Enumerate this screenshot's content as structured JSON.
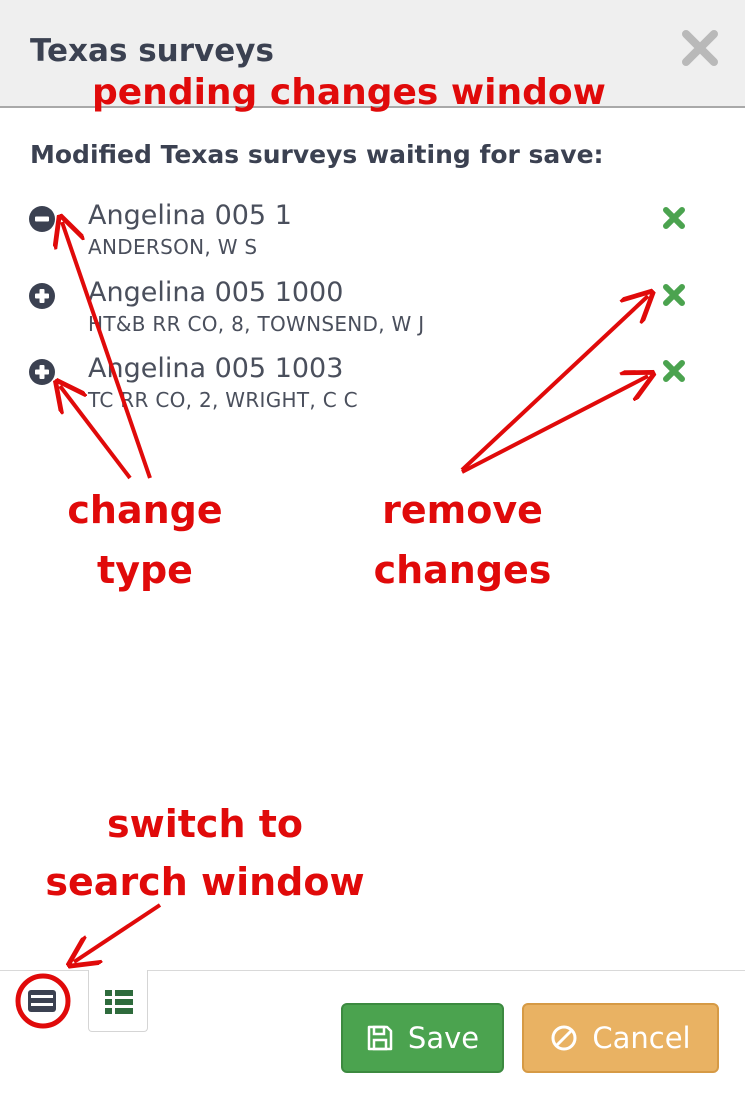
{
  "window": {
    "title": "Texas surveys"
  },
  "section": {
    "heading": "Modified Texas surveys waiting for save:"
  },
  "items": [
    {
      "title": "Angelina 005 1",
      "subtitle": "ANDERSON, W S",
      "change_type": "minus-circle-icon"
    },
    {
      "title": "Angelina 005 1000",
      "subtitle": "HT&B RR CO, 8, TOWNSEND, W J",
      "change_type": "plus-circle-icon"
    },
    {
      "title": "Angelina 005 1003",
      "subtitle": "TC RR CO, 2, WRIGHT, C C",
      "change_type": "plus-circle-icon"
    }
  ],
  "footer": {
    "tabs": [
      {
        "name": "search-window-tab",
        "icon": "server-icon"
      },
      {
        "name": "list-window-tab",
        "icon": "list-icon"
      }
    ],
    "save_label": "Save",
    "cancel_label": "Cancel"
  },
  "annotations": {
    "window_label": "pending changes window",
    "change_type_line1": "change",
    "change_type_line2": "type",
    "remove_line1": "remove",
    "remove_line2": "changes",
    "switch_line1": "switch to",
    "switch_line2": "search window"
  },
  "colors": {
    "header_bg": "#efefef",
    "text": "#3b4151",
    "remove_green": "#4ba34f",
    "save_green": "#4ba34f",
    "cancel_orange": "#e9b263",
    "annotation_red": "#e00a0a",
    "tab_icon_green": "#2e6b3c"
  }
}
